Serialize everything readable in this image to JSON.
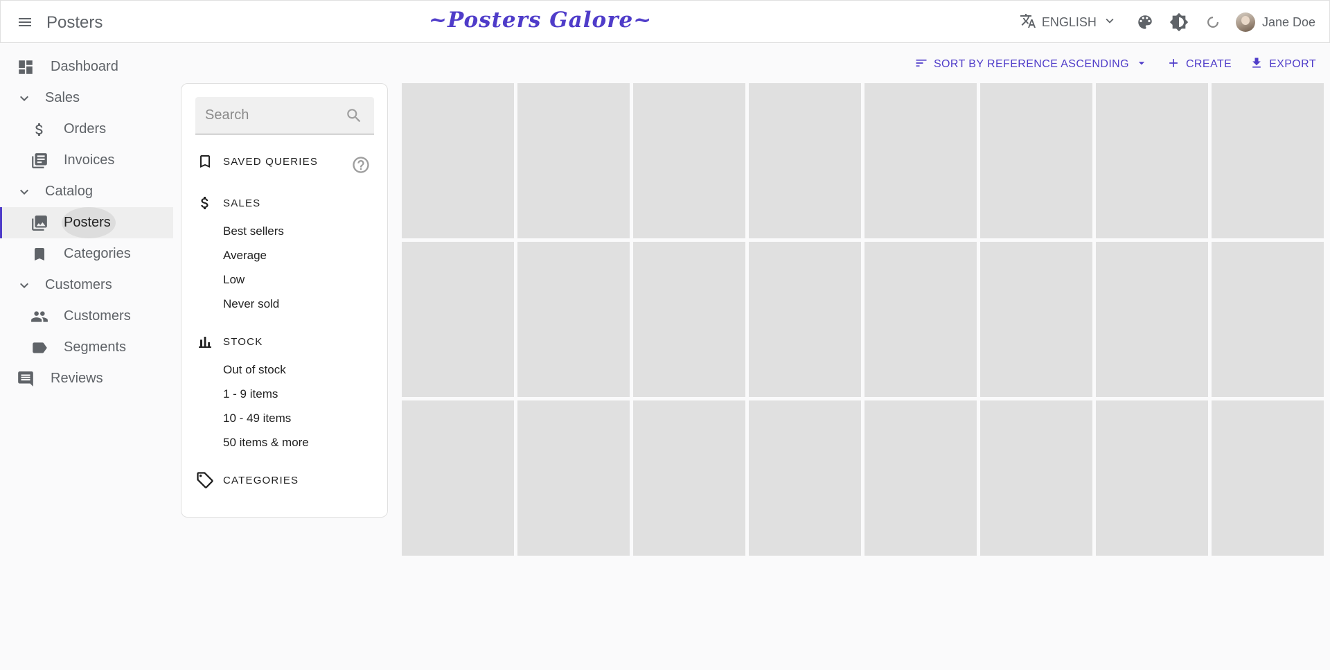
{
  "appbar": {
    "title": "Posters",
    "brand": "~Posters Galore~",
    "language": "ENGLISH",
    "user_name": "Jane Doe"
  },
  "sidebar": {
    "items": [
      {
        "label": "Dashboard",
        "icon": "dashboard-icon"
      },
      {
        "label": "Sales",
        "icon": "chevron-down-icon"
      },
      {
        "label": "Orders",
        "icon": "dollar-icon"
      },
      {
        "label": "Invoices",
        "icon": "library-books-icon"
      },
      {
        "label": "Catalog",
        "icon": "chevron-down-icon"
      },
      {
        "label": "Posters",
        "icon": "collections-icon",
        "active": true
      },
      {
        "label": "Categories",
        "icon": "bookmark-icon"
      },
      {
        "label": "Customers",
        "icon": "chevron-down-icon"
      },
      {
        "label": "Customers",
        "icon": "people-icon"
      },
      {
        "label": "Segments",
        "icon": "label-icon"
      },
      {
        "label": "Reviews",
        "icon": "comment-icon"
      }
    ]
  },
  "toolbar": {
    "sort_label": "SORT BY REFERENCE ASCENDING",
    "create_label": "CREATE",
    "export_label": "EXPORT"
  },
  "filters": {
    "search_placeholder": "Search",
    "saved_queries": "SAVED QUERIES",
    "sales": {
      "title": "SALES",
      "items": [
        "Best sellers",
        "Average",
        "Low",
        "Never sold"
      ]
    },
    "stock": {
      "title": "STOCK",
      "items": [
        "Out of stock",
        "1 - 9 items",
        "10 - 49 items",
        "50 items & more"
      ]
    },
    "categories": "CATEGORIES"
  },
  "colors": {
    "accent": "#4f3cc9",
    "placeholder_tile": "#e0e0e0"
  }
}
